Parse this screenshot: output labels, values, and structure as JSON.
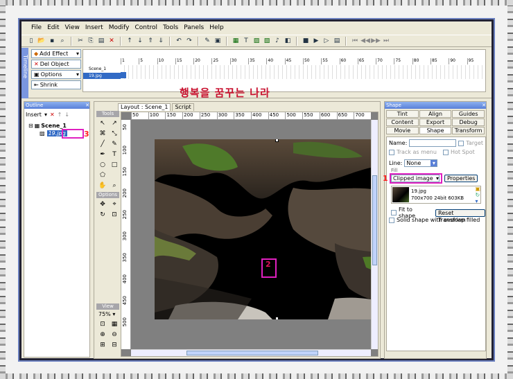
{
  "menu": [
    "File",
    "Edit",
    "View",
    "Insert",
    "Modify",
    "Control",
    "Tools",
    "Panels",
    "Help"
  ],
  "timeline": {
    "buttons": [
      "Add Effect",
      "Del Object",
      "Options",
      "Shrink"
    ],
    "scene_label": "Scene_1",
    "layer_label": "19.jpg",
    "frame_ticks": [
      "1",
      "5",
      "10",
      "15",
      "20",
      "25",
      "30",
      "35",
      "40",
      "45",
      "50",
      "55",
      "60",
      "65",
      "70",
      "75",
      "80",
      "85",
      "90",
      "95"
    ]
  },
  "korean_title": "행복을 꿈꾸는 나라",
  "outline": {
    "title": "Outline",
    "insert_label": "Insert",
    "scene": "Scene_1",
    "item": "19.jpg",
    "marker": "3"
  },
  "layout": {
    "tab_layout": "Layout : Scene_1",
    "tab_script": "Script",
    "tools_label": "Tools",
    "options_label": "Options",
    "view_label": "View",
    "zoom": "75%",
    "ruler_ticks": [
      "50",
      "100",
      "150",
      "200",
      "250",
      "300",
      "350",
      "400",
      "450",
      "500",
      "550",
      "600",
      "650",
      "700"
    ],
    "vruler_ticks": [
      "50",
      "100",
      "150",
      "200",
      "250",
      "300",
      "350",
      "400",
      "450",
      "500"
    ],
    "marker": "2"
  },
  "shape_panel": {
    "title": "Shape",
    "tabs": [
      "Tint",
      "Align",
      "Guides",
      "Content",
      "Export",
      "Debug",
      "Movie",
      "Shape",
      "Transform"
    ],
    "active_tab": "Shape",
    "name_label": "Name:",
    "target_label": "Target",
    "track_label": "Track as menu",
    "hotspot_label": "Hot Spot",
    "line_label": "Line:",
    "line_value": "None",
    "fill_label": "Fill",
    "fill_value": "Clipped image",
    "properties_btn": "Properties",
    "file_name": "19.jpg",
    "file_info": "700x700 24bit 603KB",
    "fit_label": "Fit to shape",
    "reset_btn": "Reset Transform",
    "solid_label": "Solid shape with overlap filled",
    "marker": "1"
  },
  "colors": {
    "accent": "#e020c0",
    "title_red": "#c8102e",
    "panel_blue": "#5a80d8"
  }
}
